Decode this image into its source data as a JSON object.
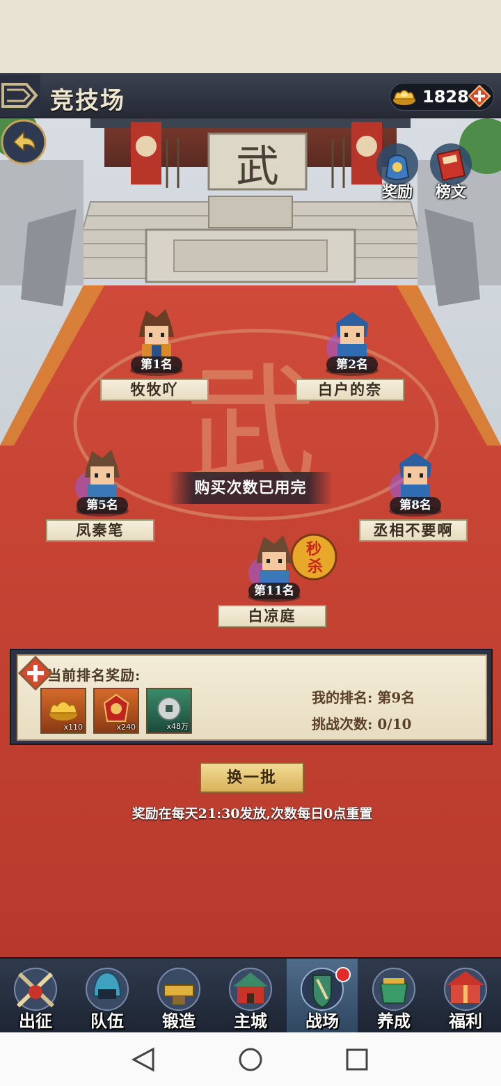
{
  "header": {
    "title": "竞技场",
    "gold": "1828"
  },
  "top_buttons": [
    {
      "label": "奖励",
      "icon": "reward-bag-icon"
    },
    {
      "label": "榜文",
      "icon": "scroll-icon"
    }
  ],
  "arena": {
    "floor_character": "武",
    "notice": "购买次数已用完",
    "kill_badge": "秒杀",
    "opponents": [
      {
        "rank": "第1名",
        "name": "牧牧吖"
      },
      {
        "rank": "第2名",
        "name": "白户的奈"
      },
      {
        "rank": "第5名",
        "name": "凤秦笔"
      },
      {
        "rank": "第8名",
        "name": "丞相不要啊"
      },
      {
        "rank": "第11名",
        "name": "白凉庭"
      }
    ]
  },
  "reward_panel": {
    "title": "当前排名奖励:",
    "items": [
      {
        "icon": "gold-ingot-icon",
        "qty": "x110"
      },
      {
        "icon": "badge-token-icon",
        "qty": "x240"
      },
      {
        "icon": "silver-coin-icon",
        "qty": "x48万"
      }
    ],
    "my_rank": "我的排名: 第9名",
    "challenges": "挑战次数: 0/10"
  },
  "refresh_label": "换一批",
  "reset_notice": "奖励在每天21:30发放,次数每日0点重置",
  "bottom_nav": [
    {
      "label": "出征",
      "icon": "crossed-swords-icon",
      "active": false
    },
    {
      "label": "队伍",
      "icon": "helmet-icon",
      "active": false
    },
    {
      "label": "锻造",
      "icon": "anvil-icon",
      "active": false
    },
    {
      "label": "主城",
      "icon": "castle-icon",
      "active": false
    },
    {
      "label": "战场",
      "icon": "battle-shield-icon",
      "active": true
    },
    {
      "label": "养成",
      "icon": "cauldron-icon",
      "active": false
    },
    {
      "label": "福利",
      "icon": "gift-pavilion-icon",
      "active": false
    }
  ],
  "colors": {
    "carpet": "#c94335",
    "header": "#2d3240",
    "nav": "#263042",
    "accent_gold": "#e8c25a"
  }
}
